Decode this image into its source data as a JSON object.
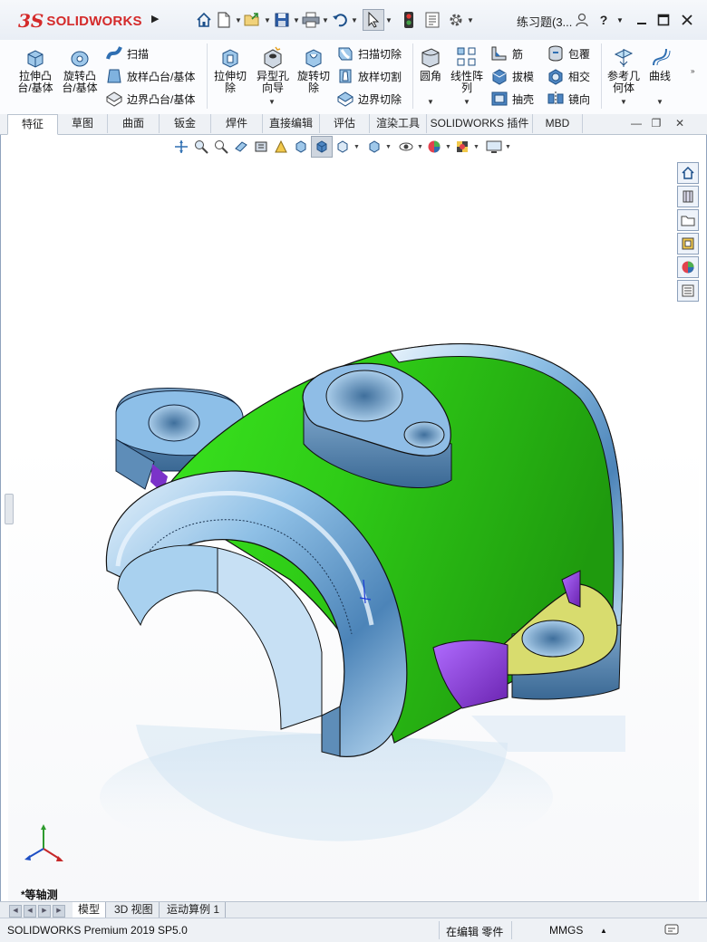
{
  "app": {
    "brand_prefix": "3S",
    "brand_name": "SOLIDWORKS",
    "document_title": "练习题(3..."
  },
  "quick_access": {
    "icons": [
      "home-icon",
      "new-document-icon",
      "open-icon",
      "save-icon",
      "print-icon",
      "undo-icon",
      "select-icon",
      "rebuild-icon",
      "file-properties-icon",
      "options-icon"
    ]
  },
  "ribbon": {
    "extrude_boss": "拉伸凸\n台/基体",
    "revolve_boss": "旋转凸\n台/基体",
    "sweep": "扫描",
    "loft": "放样凸台/基体",
    "boundary": "边界凸台/基体",
    "extrude_cut": "拉伸切\n除",
    "hole_wizard": "异型孔\n向导",
    "revolve_cut": "旋转切\n除",
    "swept_cut": "扫描切除",
    "lofted_cut": "放样切割",
    "boundary_cut": "边界切除",
    "fillet": "圆角",
    "linear_pattern": "线性阵\n列",
    "rib": "筋",
    "draft": "拔模",
    "shell": "抽壳",
    "wrap": "包覆",
    "intersect": "相交",
    "mirror": "镜向",
    "reference_geometry": "参考几\n何体",
    "curves": "曲线"
  },
  "tabs": [
    {
      "label": "特征",
      "active": true
    },
    {
      "label": "草图",
      "active": false
    },
    {
      "label": "曲面",
      "active": false
    },
    {
      "label": "钣金",
      "active": false
    },
    {
      "label": "焊件",
      "active": false
    },
    {
      "label": "直接编辑",
      "active": false
    },
    {
      "label": "评估",
      "active": false
    },
    {
      "label": "渲染工具",
      "active": false
    },
    {
      "label": "SOLIDWORKS 插件",
      "active": false
    },
    {
      "label": "MBD",
      "active": false
    }
  ],
  "viewport": {
    "view_orientation": "*等轴测"
  },
  "bottom_tabs": [
    {
      "label": "模型",
      "active": true
    },
    {
      "label": "3D 视图",
      "active": false
    },
    {
      "label": "运动算例 1",
      "active": false
    }
  ],
  "status": {
    "product": "SOLIDWORKS Premium 2019 SP5.0",
    "mode": "在编辑 零件",
    "units": "MMGS"
  },
  "colors": {
    "brand_red": "#d42a2a",
    "model_green": "#2fcc17",
    "model_blue": "#8fc0e6",
    "model_yellow": "#d8dc6e",
    "model_purple": "#8c3fd6"
  }
}
